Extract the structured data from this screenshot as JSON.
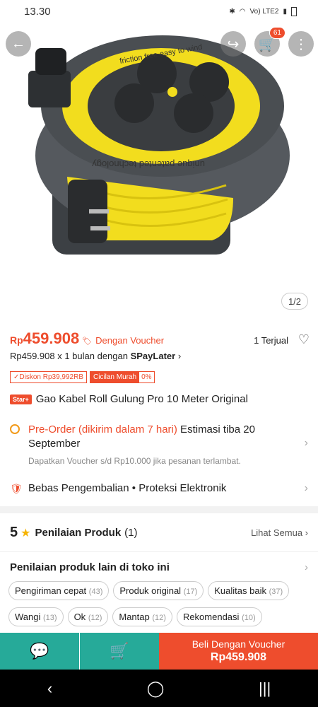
{
  "status_bar": {
    "time": "13.30",
    "network": "Vo) LTE2"
  },
  "hero": {
    "image_text_1": "friction free easy to wind",
    "image_text_2": "unique patented technology",
    "image_counter": "1/2",
    "cart_count": "61"
  },
  "price": {
    "currency": "Rp",
    "amount": "459.908",
    "voucher_label": "Dengan Voucher",
    "sold": "1 Terjual",
    "installment_pre": "Rp459.908 x 1 bulan dengan ",
    "installment_brand": "SPayLater",
    "installment_chev": "›"
  },
  "badges": {
    "discount": "✓Diskon Rp39,992RB",
    "cicilan": "Cicilan Murah",
    "cicilan_rate": "0%"
  },
  "product": {
    "star_badge": "Star+",
    "title": "Gao Kabel Roll Gulung Pro 10 Meter Original"
  },
  "preorder": {
    "highlight": "Pre-Order (dikirim dalam 7 hari)",
    "rest": " Estimasi tiba 20 September",
    "sub": "Dapatkan Voucher s/d Rp10.000 jika pesanan terlambat."
  },
  "protection": {
    "text": "Bebas Pengembalian  •  Proteksi Elektronik"
  },
  "rating": {
    "score": "5",
    "title": "Penilaian Produk",
    "count": "(1)",
    "see_all": "Lihat Semua ›"
  },
  "shop_reviews": {
    "title": "Penilaian produk lain di toko ini",
    "tags": [
      {
        "label": "Pengiriman cepat",
        "count": "(43)"
      },
      {
        "label": "Produk original",
        "count": "(17)"
      },
      {
        "label": "Kualitas baik",
        "count": "(37)"
      },
      {
        "label": "Wangi",
        "count": "(13)"
      },
      {
        "label": "Ok",
        "count": "(12)"
      },
      {
        "label": "Mantap",
        "count": "(12)"
      },
      {
        "label": "Rekomendasi",
        "count": "(10)"
      }
    ]
  },
  "bottom_bar": {
    "buy_label": "Beli Dengan Voucher",
    "buy_price": "Rp459.908"
  },
  "colors": {
    "brand": "#ee4d2d",
    "teal": "#26aa99",
    "star": "#f6b400"
  }
}
